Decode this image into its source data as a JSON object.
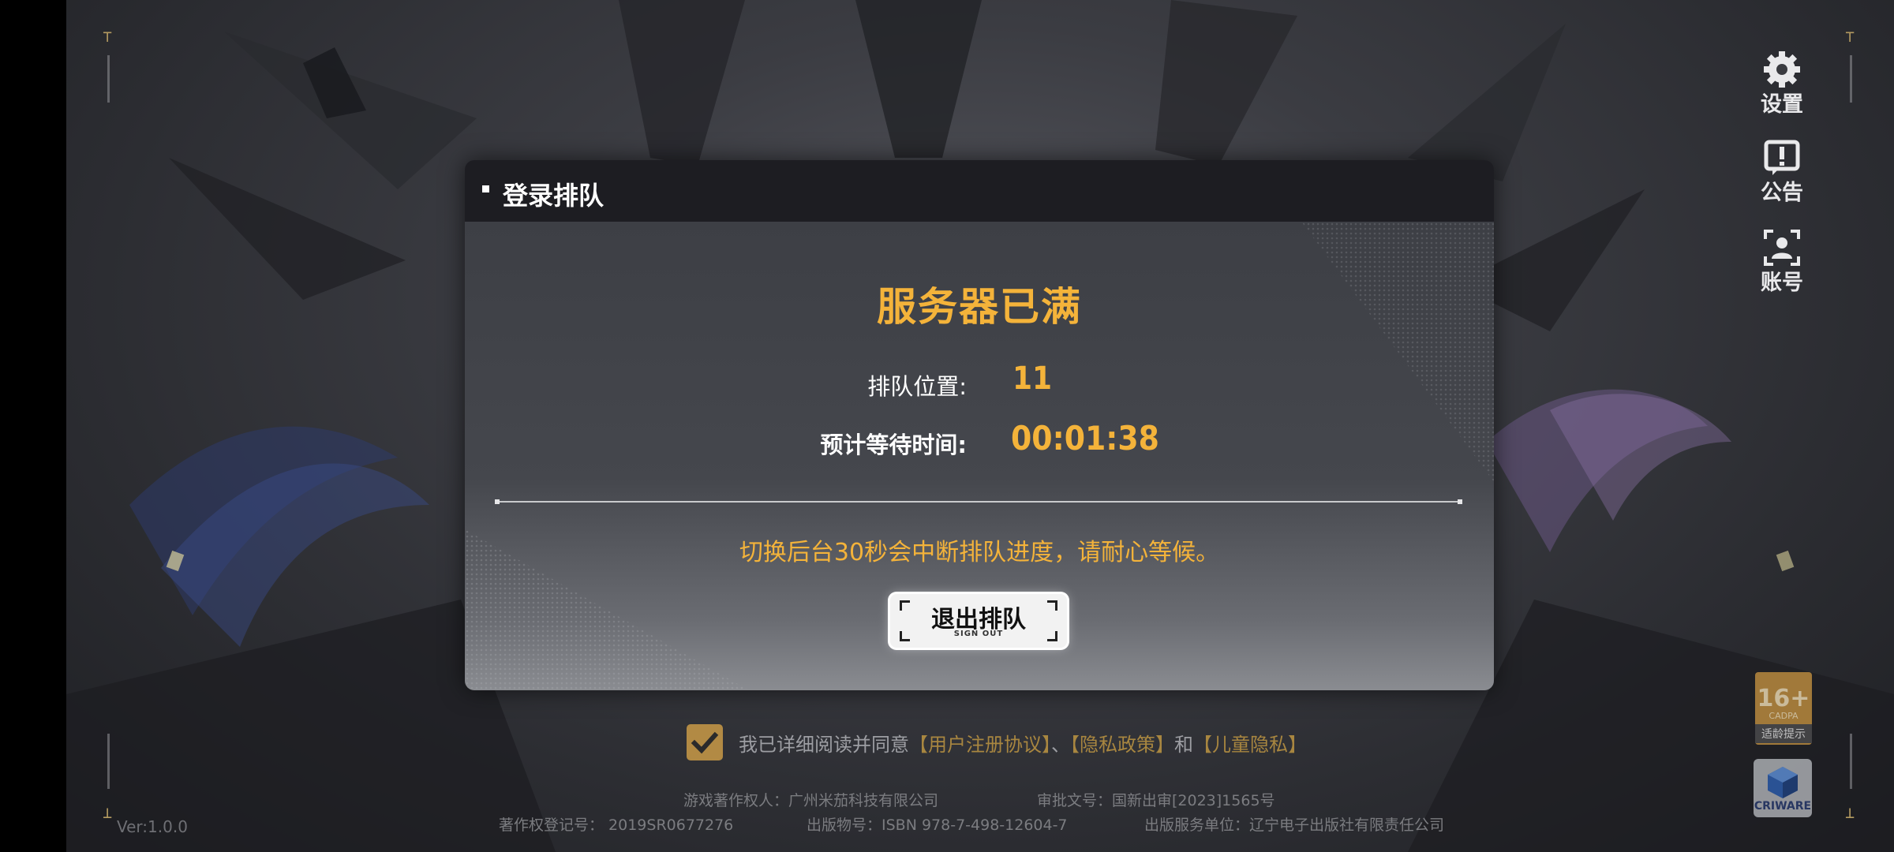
{
  "dialog": {
    "title": "登录排队",
    "heading": "服务器已满",
    "queue_label": "排队位置:",
    "queue_value": "11",
    "wait_label": "预计等待时间:",
    "wait_value": "00:01:38",
    "notice": "切换后台30秒会中断排队进度，请耐心等候。",
    "exit_button": "退出排队",
    "exit_button_sub": "SIGN OUT"
  },
  "side_menu": [
    {
      "label": "设置",
      "icon": "gear-icon"
    },
    {
      "label": "公告",
      "icon": "notice-icon"
    },
    {
      "label": "账号",
      "icon": "account-icon"
    }
  ],
  "agreement": {
    "checked": true,
    "prefix": "我已详细阅读并同意",
    "link1": "【用户注册协议】",
    "sep1": "、",
    "link2": "【隐私政策】",
    "sep2": "和",
    "link3": "【儿童隐私】"
  },
  "footer": {
    "copyright_owner": "游戏著作权人：广州米茄科技有限公司",
    "approval": "审批文号：国新出审[2023]1565号",
    "registration": "著作权登记号： 2019SR0677276",
    "isbn": "出版物号：ISBN 978-7-498-12604-7",
    "publisher": "出版服务单位：辽宁电子出版社有限责任公司"
  },
  "version": "Ver:1.0.0",
  "age_badge": {
    "number": "16+",
    "org": "CADPA",
    "label": "适龄提示"
  },
  "cri_badge": "CRIWARE",
  "colors": {
    "accent": "#f4b33a",
    "link": "#a88640",
    "header": "#1d1d22"
  }
}
